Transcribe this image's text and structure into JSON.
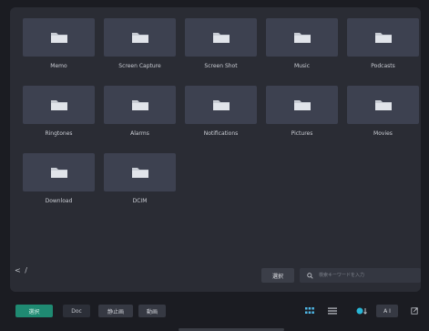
{
  "folders": [
    {
      "name": "Memo"
    },
    {
      "name": "Screen Capture"
    },
    {
      "name": "Screen Shot"
    },
    {
      "name": "Music"
    },
    {
      "name": "Podcasts"
    },
    {
      "name": "Ringtones"
    },
    {
      "name": "Alarms"
    },
    {
      "name": "Notifications"
    },
    {
      "name": "Pictures"
    },
    {
      "name": "Movies"
    },
    {
      "name": "Download"
    },
    {
      "name": "DCIM"
    }
  ],
  "nav": {
    "arrows": "< /"
  },
  "toolbar": {
    "select_label": "選択",
    "search_placeholder": "検索キーワードを入力"
  },
  "bottom": {
    "tab_active": "選択",
    "tab_doc": "Doc",
    "tab_still": "静止画",
    "tab_video": "動画",
    "ai_label": "A I"
  },
  "colors": {
    "background": "#1b1c22",
    "panel": "#2a2c34",
    "thumb": "#3d4150",
    "accent": "#1f8a72"
  },
  "icons": {
    "folder": "folder-icon",
    "search": "search-icon",
    "grid": "grid-icon",
    "list": "list-icon",
    "sort": "sort-icon",
    "open": "open-external-icon"
  }
}
